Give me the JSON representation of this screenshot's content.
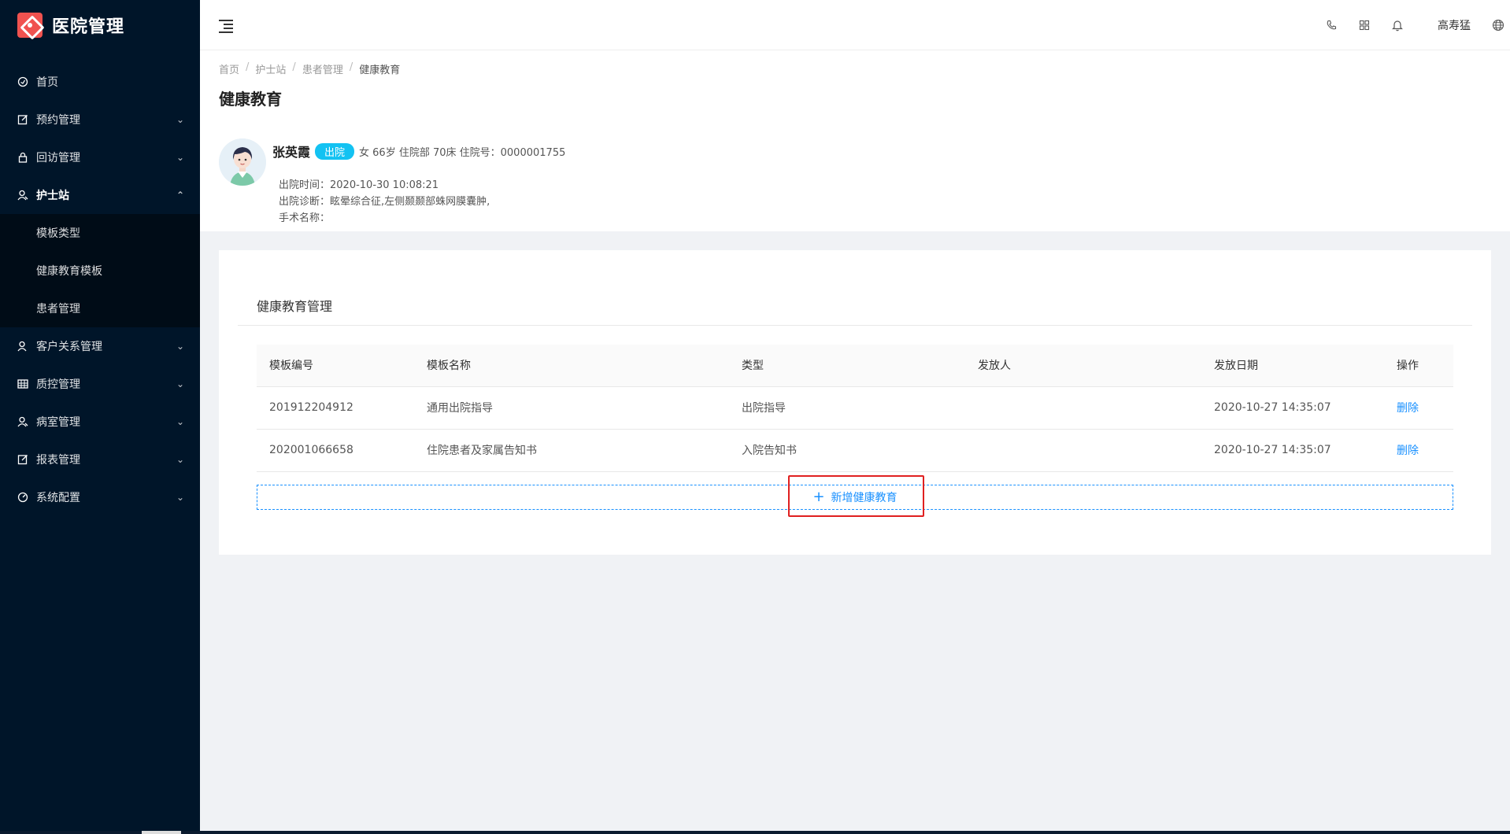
{
  "app": {
    "title": "医院管理"
  },
  "sidebar": {
    "items": [
      {
        "label": "首页",
        "icon": "dashboard-icon",
        "chevron": ""
      },
      {
        "label": "预约管理",
        "icon": "edit-icon",
        "chevron": "⌄"
      },
      {
        "label": "回访管理",
        "icon": "lock-icon",
        "chevron": "⌄"
      },
      {
        "label": "护士站",
        "icon": "user-icon",
        "chevron": "⌃"
      },
      {
        "label": "客户关系管理",
        "icon": "user-icon",
        "chevron": "⌄"
      },
      {
        "label": "质控管理",
        "icon": "table-icon",
        "chevron": "⌄"
      },
      {
        "label": "病室管理",
        "icon": "user-icon",
        "chevron": "⌄"
      },
      {
        "label": "报表管理",
        "icon": "edit-icon",
        "chevron": "⌄"
      },
      {
        "label": "系统配置",
        "icon": "dashboard-icon",
        "chevron": "⌄"
      }
    ],
    "submenu": [
      {
        "label": "模板类型"
      },
      {
        "label": "健康教育模板"
      },
      {
        "label": "患者管理"
      }
    ]
  },
  "header": {
    "username": "高寿猛",
    "icons": [
      "phone-icon",
      "apps-icon",
      "bell-icon",
      "globe-icon"
    ]
  },
  "breadcrumb": [
    "首页",
    "护士站",
    "患者管理",
    "健康教育"
  ],
  "page_title": "健康教育",
  "patient": {
    "name": "张英霞",
    "status": "出院",
    "info": "女 66岁  住院部   70床  住院号：0000001755",
    "discharge_time": "出院时间：2020-10-30 10:08:21",
    "diagnosis": "出院诊断：眩晕综合征,左侧颞颞部蛛网膜囊肿,",
    "surgery": "手术名称："
  },
  "card": {
    "title": "健康教育管理",
    "columns": [
      "模板编号",
      "模板名称",
      "类型",
      "发放人",
      "发放日期",
      "操作"
    ],
    "rows": [
      [
        "201912204912",
        "通用出院指导",
        "出院指导",
        "",
        "2020-10-27 14:35:07",
        "删除"
      ],
      [
        "202001066658",
        "住院患者及家属告知书",
        "入院告知书",
        "",
        "2020-10-27 14:35:07",
        "删除"
      ]
    ],
    "add_label": "新增健康教育"
  },
  "colors": {
    "sidebar": "#001529",
    "accent": "#1890ff",
    "badge": "#13c2f2",
    "highlight": "#e02020"
  }
}
